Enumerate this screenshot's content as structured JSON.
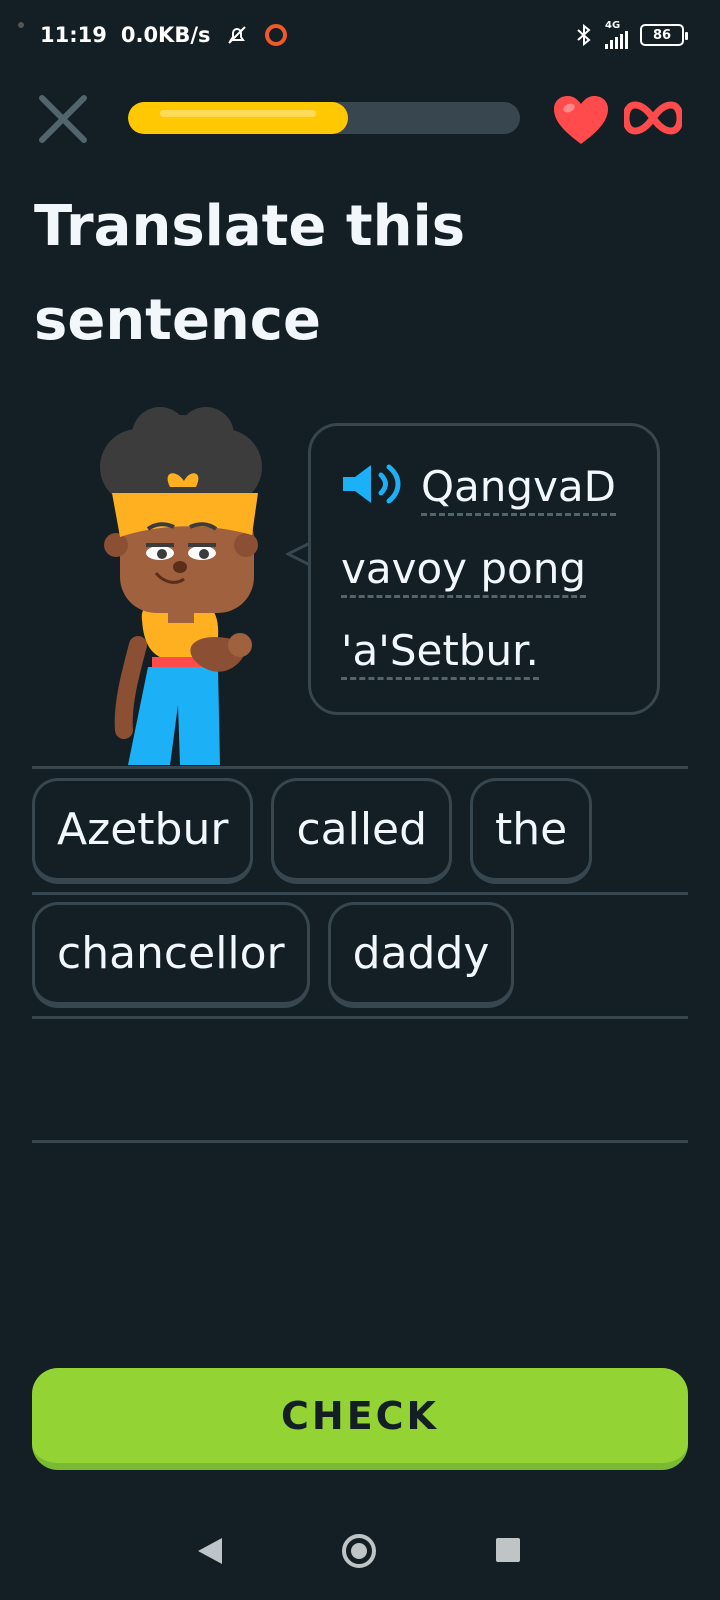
{
  "status_bar": {
    "time": "11:19",
    "network_speed": "0.0KB/s",
    "network_type": "4G",
    "battery": "86",
    "icons": [
      "bell-off-icon",
      "circle-record-icon",
      "bluetooth-icon",
      "signal-icon",
      "battery-icon"
    ]
  },
  "header": {
    "progress": 0.56,
    "close_icon": "close-icon",
    "hearts": "infinity",
    "colors": {
      "progress_fill": "#ffc800",
      "progress_track": "#37464f",
      "heart": "#ff4b4b"
    }
  },
  "title": "Translate this sentence",
  "prompt": {
    "words": [
      "QangvaD",
      "vavoy pong",
      "'a'Setbur."
    ],
    "speaker_icon": "speaker-icon"
  },
  "word_bank": {
    "row1": [
      "Azetbur",
      "called",
      "the"
    ],
    "row2": [
      "chancellor",
      "daddy"
    ]
  },
  "check_button": {
    "label": "CHECK",
    "color": "#93d333"
  },
  "nav": {
    "icons": [
      "back-icon",
      "home-icon",
      "recent-apps-icon"
    ]
  }
}
